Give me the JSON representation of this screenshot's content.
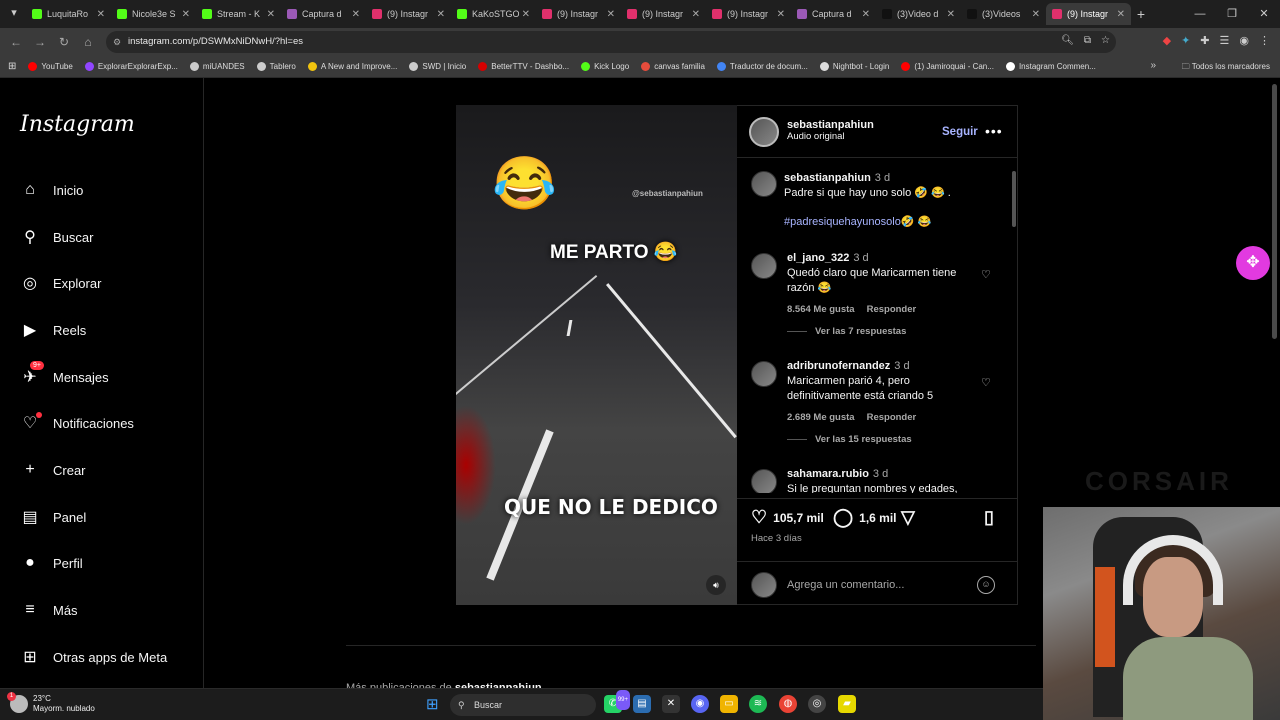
{
  "browser": {
    "tabs": [
      {
        "title": "LuquitaRo",
        "color": "#53fc18"
      },
      {
        "title": "Nicole3e S",
        "color": "#53fc18"
      },
      {
        "title": "Stream - K",
        "color": "#53fc18"
      },
      {
        "title": "Captura d",
        "color": "#9b59b6"
      },
      {
        "title": "(9) Instagr",
        "color": "#e1306c"
      },
      {
        "title": "KaKoSTGO",
        "color": "#53fc18"
      },
      {
        "title": "(9) Instagr",
        "color": "#e1306c"
      },
      {
        "title": "(9) Instagr",
        "color": "#e1306c"
      },
      {
        "title": "(9) Instagr",
        "color": "#e1306c"
      },
      {
        "title": "Captura d",
        "color": "#9b59b6"
      },
      {
        "title": "(3)Video d",
        "color": "#111111"
      },
      {
        "title": "(3)Videos",
        "color": "#111111"
      },
      {
        "title": "(9) Instagr",
        "color": "#e1306c",
        "active": true
      }
    ],
    "url": "instagram.com/p/DSWMxNiDNwH/?hl=es",
    "bookmarks": [
      {
        "label": "YouTube",
        "color": "#ff0000"
      },
      {
        "label": "ExplorarExplorarExp...",
        "color": "#9146ff"
      },
      {
        "label": "miUANDES",
        "color": "#cccccc"
      },
      {
        "label": "Tablero",
        "color": "#cccccc"
      },
      {
        "label": "A New and Improve...",
        "color": "#f1c40f"
      },
      {
        "label": "SWD | Inicio",
        "color": "#cccccc"
      },
      {
        "label": "BetterTTV - Dashbo...",
        "color": "#d50000"
      },
      {
        "label": "Kick Logo",
        "color": "#53fc18"
      },
      {
        "label": "canvas familia",
        "color": "#e74c3c"
      },
      {
        "label": "Traductor de docum...",
        "color": "#4285f4"
      },
      {
        "label": "Nightbot - Login",
        "color": "#dddddd"
      },
      {
        "label": "(1) Jamiroquai - Can...",
        "color": "#ff0000"
      },
      {
        "label": "Instagram Commen...",
        "color": "#ffffff"
      }
    ],
    "bookmarks_all": "Todos los marcadores"
  },
  "sidebar": {
    "logo": "Instagram",
    "items": [
      {
        "label": "Inicio",
        "icon": "⌂"
      },
      {
        "label": "Buscar",
        "icon": "⚲"
      },
      {
        "label": "Explorar",
        "icon": "◎"
      },
      {
        "label": "Reels",
        "icon": "▶"
      },
      {
        "label": "Mensajes",
        "icon": "✈",
        "badge": "9+"
      },
      {
        "label": "Notificaciones",
        "icon": "♡",
        "dot": true
      },
      {
        "label": "Crear",
        "icon": "+"
      },
      {
        "label": "Panel",
        "icon": "▤"
      },
      {
        "label": "Perfil",
        "icon": "●"
      },
      {
        "label": "Más",
        "icon": "≡"
      },
      {
        "label": "Otras apps de Meta",
        "icon": "⊞"
      }
    ]
  },
  "post": {
    "overlay_handle": "@sebastianpahiun",
    "overlay_emoji": "😂",
    "overlay_top": "ME PARTO 😂",
    "overlay_bottom": "QUE NO LE DEDICO",
    "author": "sebastianpahiun",
    "audio": "Audio original",
    "follow_label": "Seguir",
    "caption": {
      "user": "sebastianpahiun",
      "time": "3 d",
      "text": "Padre si que hay uno solo 🤣 😂 .",
      "hashtags": "#padresiquehayunosolo🤣 😂"
    },
    "comments": [
      {
        "user": "el_jano_322",
        "time": "3 d",
        "text": "Quedó claro que Maricarmen tiene razón 😂",
        "likes": "8.564 Me gusta",
        "reply": "Responder",
        "replies": "Ver las 7 respuestas"
      },
      {
        "user": "adribrunofernandez",
        "time": "3 d",
        "text": "Maricarmen parió 4, pero definitivamente está criando 5",
        "likes": "2.689 Me gusta",
        "reply": "Responder",
        "replies": "Ver las 15 respuestas"
      },
      {
        "user": "sahamara.rubio",
        "time": "3 d",
        "text": "Si le preguntan nombres y edades,"
      }
    ],
    "likes": "105,7 mil",
    "comments_count": "1,6 mil",
    "time_ago": "Hace 3 días",
    "comment_placeholder": "Agrega un comentario...",
    "more_posts_prefix": "Más publicaciones de ",
    "more_posts_user": "sebastianpahiun"
  },
  "stream": {
    "brand": "CORSAIR"
  },
  "taskbar": {
    "temperature": "23°C",
    "weather": "Mayorm. nublado",
    "weather_badge": "1",
    "search": "Buscar",
    "whatsapp_badge": "99+"
  }
}
